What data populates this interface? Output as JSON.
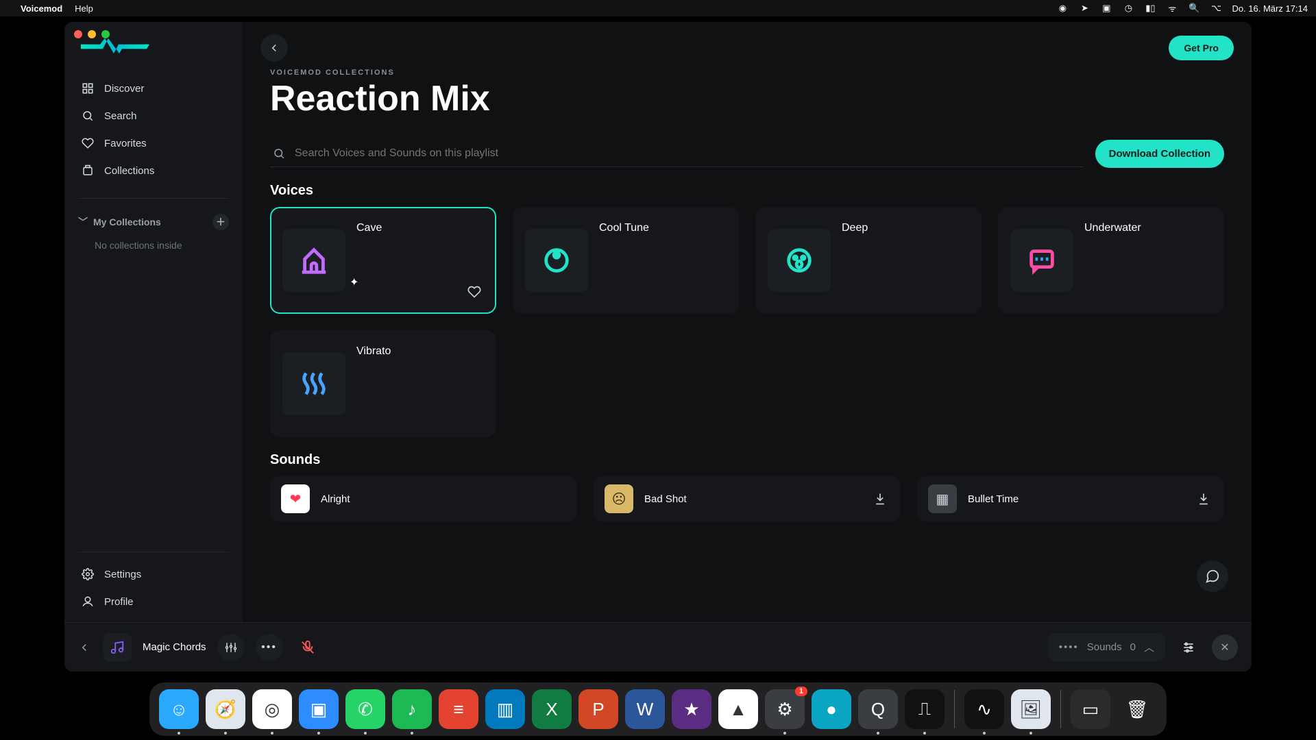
{
  "menubar": {
    "app_name": "Voicemod",
    "help_label": "Help",
    "datetime": "Do. 16. März  17:14"
  },
  "sidebar": {
    "nav": [
      {
        "label": "Discover",
        "icon": "discover-icon"
      },
      {
        "label": "Search",
        "icon": "search-icon"
      },
      {
        "label": "Favorites",
        "icon": "heart-icon"
      },
      {
        "label": "Collections",
        "icon": "collections-icon"
      }
    ],
    "my_collections_label": "My Collections",
    "my_collections_empty": "No collections inside",
    "bottom": [
      {
        "label": "Settings",
        "icon": "gear-icon"
      },
      {
        "label": "Profile",
        "icon": "profile-icon"
      }
    ]
  },
  "header": {
    "sublabel": "VOICEMOD COLLECTIONS",
    "title": "Reaction Mix",
    "get_pro_label": "Get Pro",
    "search_placeholder": "Search Voices and Sounds on this playlist",
    "download_label": "Download Collection"
  },
  "sections": {
    "voices_label": "Voices",
    "sounds_label": "Sounds"
  },
  "voices": [
    {
      "name": "Cave",
      "selected": true,
      "icon": "cave-icon",
      "icon_color": "#c36bff"
    },
    {
      "name": "Cool Tune",
      "selected": false,
      "icon": "dial-icon",
      "icon_color": "#22e3c8"
    },
    {
      "name": "Deep",
      "selected": false,
      "icon": "face-icon",
      "icon_color": "#22e3c8"
    },
    {
      "name": "Underwater",
      "selected": false,
      "icon": "chat-wave-icon",
      "icon_color": "#29a9ff"
    },
    {
      "name": "Vibrato",
      "selected": false,
      "icon": "wave-icon",
      "icon_color": "#4aa3ff"
    }
  ],
  "sounds": [
    {
      "name": "Alright",
      "thumb_bg": "#ffffff",
      "thumb_fg": "#ff3b5c",
      "glyph": "❤"
    },
    {
      "name": "Bad Shot",
      "thumb_bg": "#d9b86a",
      "thumb_fg": "#3a2b00",
      "glyph": "☹"
    },
    {
      "name": "Bullet Time",
      "thumb_bg": "#3a3d42",
      "thumb_fg": "#cfd4da",
      "glyph": "▦"
    }
  ],
  "footer": {
    "now_playing": "Magic Chords",
    "sounds_label": "Sounds",
    "sounds_count": "0"
  },
  "dock": {
    "items": [
      {
        "name": "Finder",
        "bg": "#2aa9ff",
        "glyph": "☺",
        "running": true
      },
      {
        "name": "Safari",
        "bg": "#dfe6ee",
        "glyph": "🧭",
        "running": true
      },
      {
        "name": "Chrome",
        "bg": "#ffffff",
        "glyph": "◎",
        "running": true
      },
      {
        "name": "Zoom",
        "bg": "#2d8cff",
        "glyph": "▣",
        "running": true
      },
      {
        "name": "WhatsApp",
        "bg": "#25d366",
        "glyph": "✆",
        "running": true
      },
      {
        "name": "Spotify",
        "bg": "#1db954",
        "glyph": "♪",
        "running": true
      },
      {
        "name": "Todoist",
        "bg": "#e44332",
        "glyph": "≡",
        "running": false
      },
      {
        "name": "Trello",
        "bg": "#0079bf",
        "glyph": "▥",
        "running": false
      },
      {
        "name": "Excel",
        "bg": "#107c41",
        "glyph": "X",
        "running": false
      },
      {
        "name": "PowerPoint",
        "bg": "#d24726",
        "glyph": "P",
        "running": false
      },
      {
        "name": "Word",
        "bg": "#2b579a",
        "glyph": "W",
        "running": false
      },
      {
        "name": "iMovie",
        "bg": "#5a2d82",
        "glyph": "★",
        "running": false
      },
      {
        "name": "Drive",
        "bg": "#ffffff",
        "glyph": "▲",
        "running": false
      },
      {
        "name": "Settings",
        "bg": "#3a3d42",
        "glyph": "⚙",
        "running": true,
        "badge": "1"
      },
      {
        "name": "Siri",
        "bg": "#0aa5c2",
        "glyph": "●",
        "running": false
      },
      {
        "name": "QuickTime",
        "bg": "#3a3d42",
        "glyph": "Q",
        "running": true
      },
      {
        "name": "VoiceMemos",
        "bg": "#111",
        "glyph": "⎍",
        "running": true
      }
    ],
    "pinned": [
      {
        "name": "Voicemod",
        "bg": "#111",
        "glyph": "∿",
        "running": true
      },
      {
        "name": "Preview",
        "bg": "#dfe6ee",
        "glyph": "🖼",
        "running": true
      }
    ],
    "tray": [
      {
        "name": "DesktopItem",
        "bg": "#2b2b2b",
        "glyph": "▭"
      },
      {
        "name": "Trash",
        "bg": "transparent",
        "glyph": "🗑"
      }
    ]
  }
}
